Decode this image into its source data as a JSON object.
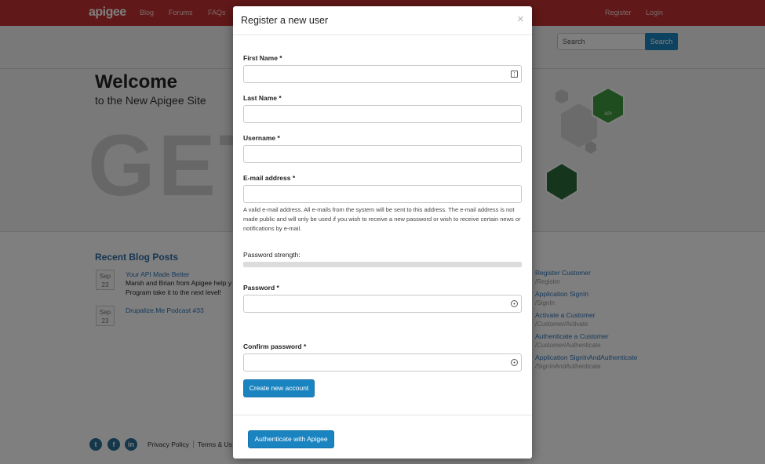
{
  "header": {
    "logo": "apigee",
    "nav": [
      "Blog",
      "Forums",
      "FAQs"
    ],
    "auth": [
      "Register",
      "Login"
    ],
    "search_placeholder": "Search",
    "search_button": "Search"
  },
  "hero": {
    "title": "Welcome",
    "subtitle": "to the New Apigee Site",
    "big_text": "GET",
    "badge_text": "API"
  },
  "blog": {
    "heading": "Recent Blog Posts",
    "posts": [
      {
        "month": "Sep",
        "day": "23",
        "title": "Your API Made Better",
        "body_1": "Marsh and Brian from Apigee help y",
        "body_2": "Program take it to the next level!"
      },
      {
        "month": "Sep",
        "day": "23",
        "title": "Drupalize.Me Podcast #33"
      }
    ]
  },
  "sidebar_links": [
    {
      "label": "Register Customer",
      "path": "/Register"
    },
    {
      "label": "Application SignIn",
      "path": "/SignIn"
    },
    {
      "label": "Activate a Customer",
      "path": "/Customer/Activate"
    },
    {
      "label": "Authenticate a Customer",
      "path": "/Customer/Authenticate"
    },
    {
      "label": "Application SignInAndAuthenticate",
      "path": "/SignInAndAuthenticate"
    }
  ],
  "footer": {
    "social": [
      "t",
      "f",
      "in"
    ],
    "links": [
      "Privacy Policy",
      "Terms & Us"
    ]
  },
  "modal": {
    "title": "Register a new user",
    "close": "×",
    "first_name_label": "First Name *",
    "last_name_label": "Last Name *",
    "username_label": "Username *",
    "email_label": "E-mail address *",
    "email_help": "A valid e-mail address. All e-mails from the system will be sent to this address. The e-mail address is not made public and will only be used if you wish to receive a new password or wish to receive certain news or notifications by e-mail.",
    "password_strength_label": "Password strength:",
    "password_label": "Password *",
    "confirm_password_label": "Confirm password *",
    "create_button": "Create new account",
    "auth_button": "Authenticate with Apigee"
  },
  "colors": {
    "brand_red": "#c33131",
    "button_blue": "#1a84c1",
    "link_blue": "#2a73b8"
  }
}
